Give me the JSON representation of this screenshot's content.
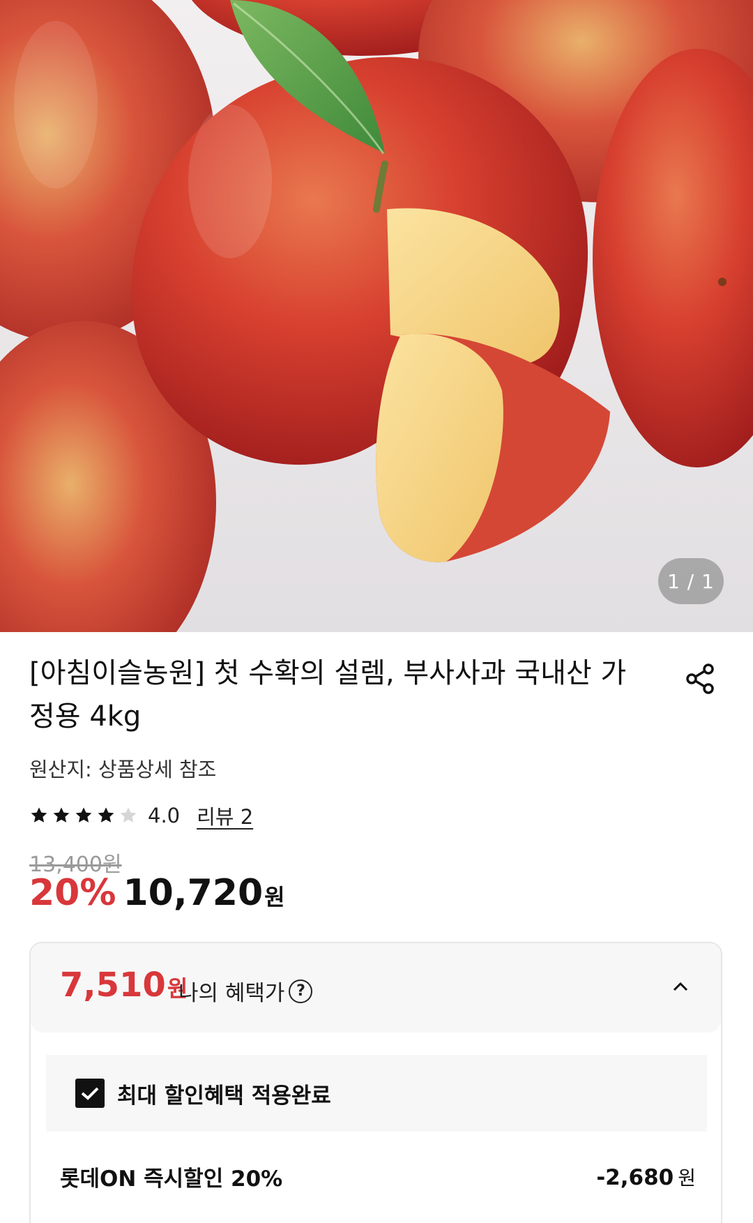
{
  "gallery": {
    "counter": "1 / 1"
  },
  "product": {
    "title": "[아침이슬농원] 첫 수확의 설렘, 부사사과 국내산 가정용 4kg",
    "origin": "원산지: 상품상세 참조"
  },
  "rating": {
    "score": "4.0",
    "review_label": "리뷰 2",
    "stars_filled": 4,
    "stars_total": 5
  },
  "price": {
    "original": "13,400원",
    "discount_rate": "20%",
    "sale_price": "10,720",
    "unit": "원"
  },
  "benefit": {
    "amount": "7,510",
    "unit": "원",
    "label": "나의 혜택가",
    "applied_text": "최대 할인혜택 적용완료",
    "discounts": [
      {
        "name": "롯데ON 즉시할인 20%",
        "value": "-2,680",
        "unit": "원"
      }
    ]
  },
  "colors": {
    "accent_red": "#d8373b",
    "text": "#111111",
    "muted": "#9a9a9a",
    "panel_bg": "#f7f7f7"
  },
  "icons": {
    "share": "share-icon",
    "help": "question-circle-icon",
    "collapse": "chevron-up-icon",
    "check": "check-icon"
  }
}
